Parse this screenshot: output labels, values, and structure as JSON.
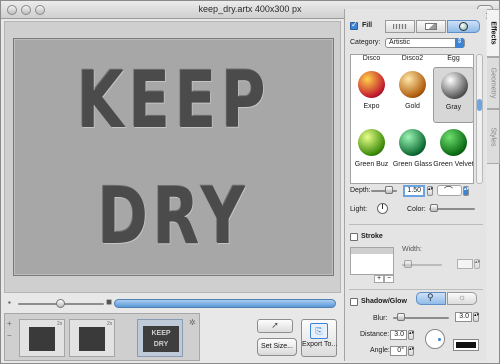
{
  "window": {
    "title": "keep_dry.artx 400x300 px"
  },
  "canvas": {
    "line1": "KEEP",
    "line2": "DRY"
  },
  "filmstrip": {
    "thumb_mini_line1": "KEEP",
    "thumb_mini_line2": "DRY",
    "add": "+",
    "remove": "−",
    "small_label": "2x"
  },
  "toolbar": {
    "set_size": "Set Size...",
    "export": "Export To..."
  },
  "inspector": {
    "tabs": {
      "effects": "Effects",
      "geometry": "Geometry",
      "styles": "Styles"
    },
    "fill": {
      "label": "Fill",
      "enabled": true,
      "category_label": "Category:",
      "category_value": "Artistic",
      "header_names": [
        "Disco",
        "Disco2",
        "Egg"
      ],
      "styles": [
        {
          "name": "Expo",
          "color1": "#ffd14a",
          "color2": "#c2172d"
        },
        {
          "name": "Gold",
          "color1": "#ffe7a8",
          "color2": "#b05c0c"
        },
        {
          "name": "Gray",
          "color1": "#ffffff",
          "color2": "#555555",
          "selected": true
        },
        {
          "name": "Green Buz",
          "color1": "#e8ff8a",
          "color2": "#3a8a08"
        },
        {
          "name": "Green Glass",
          "color1": "#9cf5b4",
          "color2": "#0c6a32"
        },
        {
          "name": "Green Velvet",
          "color1": "#6ee06e",
          "color2": "#0a6a12"
        }
      ],
      "depth_label": "Depth:",
      "depth_value": "1.50",
      "light_label": "Light:",
      "color_label": "Color:"
    },
    "stroke": {
      "label": "Stroke",
      "enabled": false,
      "width_label": "Width:",
      "add": "+",
      "remove": "−"
    },
    "shadow": {
      "label": "Shadow/Glow",
      "enabled": false,
      "blur_label": "Blur:",
      "blur_value": "3.0",
      "distance_label": "Distance:",
      "distance_value": "3.0",
      "angle_label": "Angle:",
      "angle_value": "0°",
      "color": "#111111"
    }
  },
  "colors": {
    "accent": "#3e84d4",
    "scroll": "#5a98d8"
  }
}
